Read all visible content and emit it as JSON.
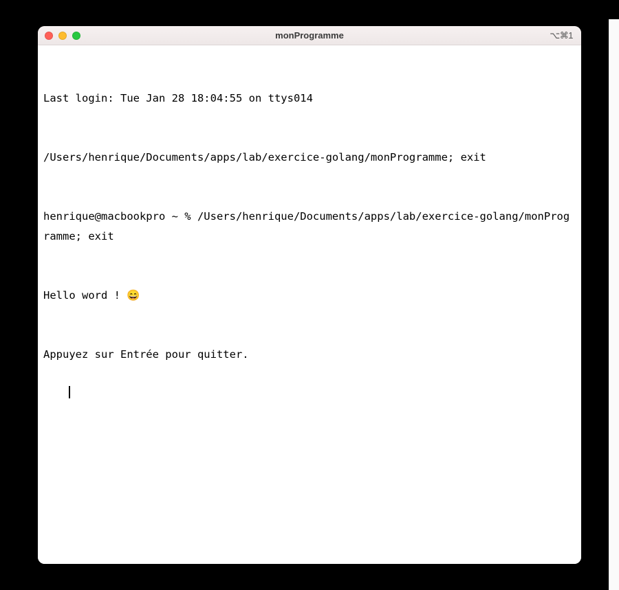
{
  "window": {
    "title": "monProgramme",
    "shortcut_hint": "⌥⌘1"
  },
  "terminal": {
    "lines": [
      "Last login: Tue Jan 28 18:04:55 on ttys014",
      "/Users/henrique/Documents/apps/lab/exercice-golang/monProgramme; exit",
      "henrique@macbookpro ~ % /Users/henrique/Documents/apps/lab/exercice-golang/monProgramme; exit",
      "Hello word ! 😄",
      "Appuyez sur Entrée pour quitter."
    ]
  }
}
